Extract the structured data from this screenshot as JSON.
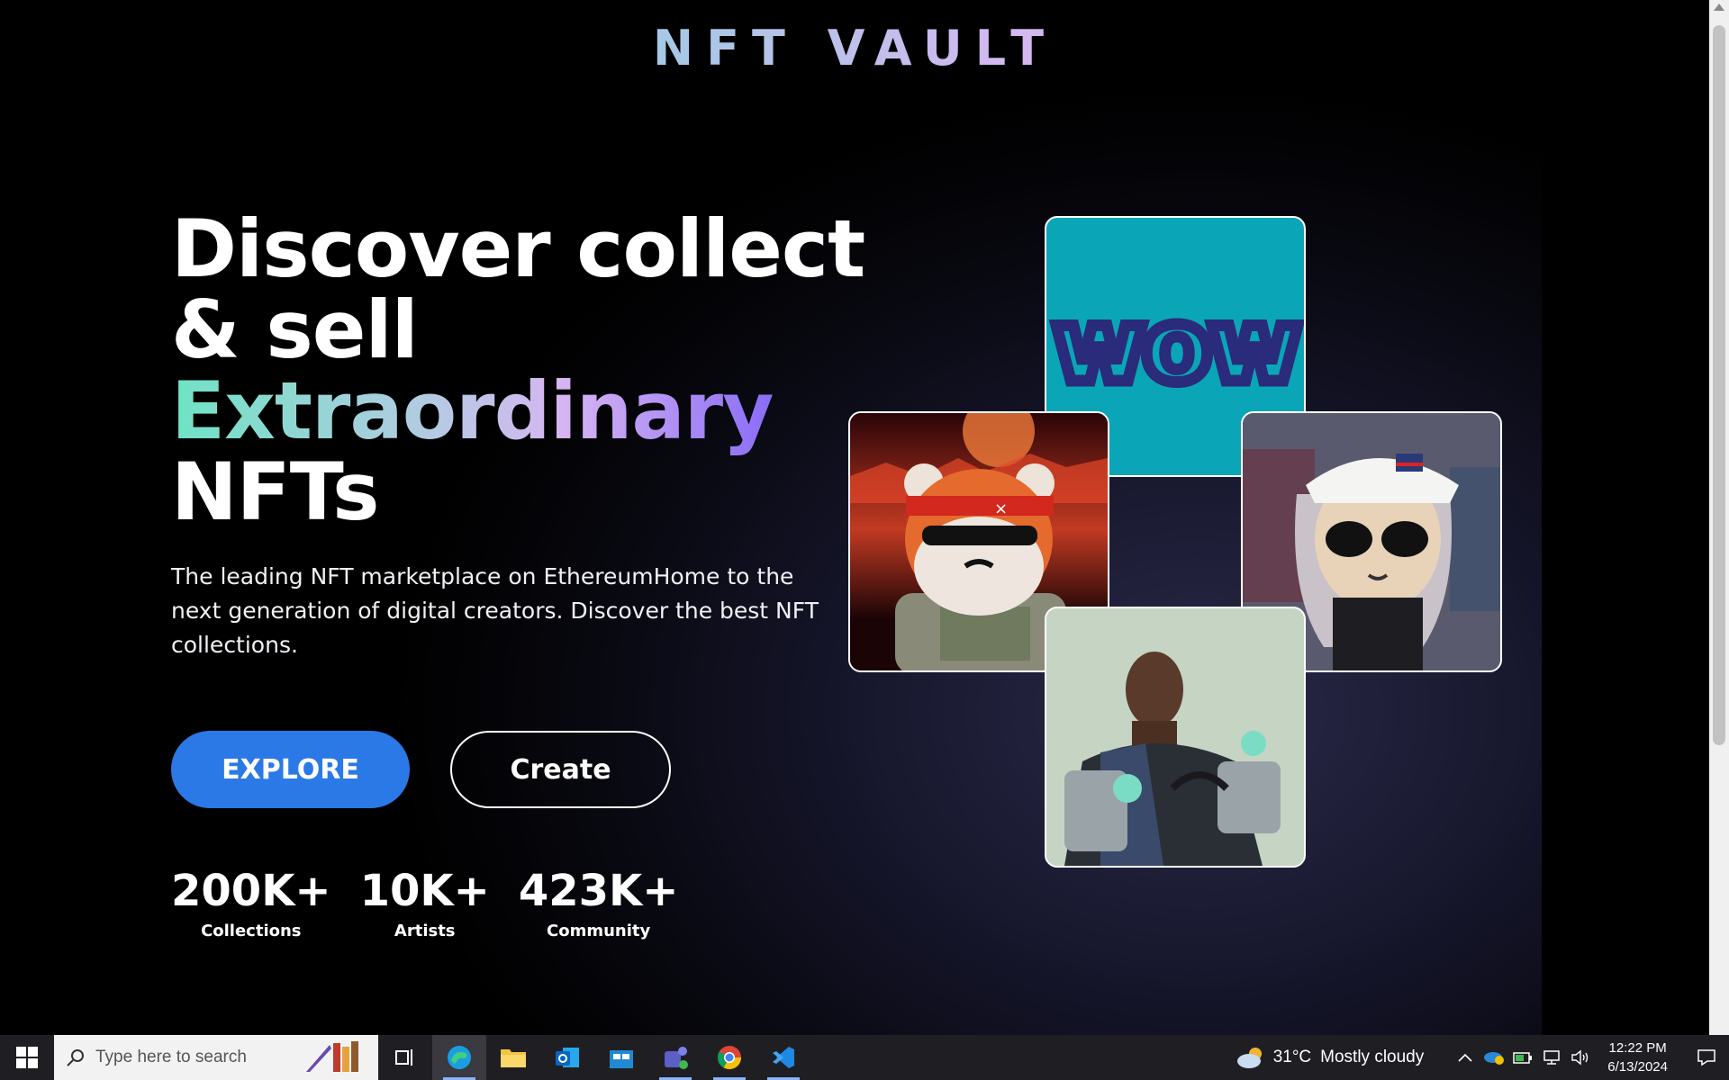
{
  "brand": "NFT VAULT",
  "hero": {
    "line1": "Discover collect",
    "line2": "& sell",
    "line3": "Extraordinary",
    "line4": "NFTs",
    "description": "The leading NFT marketplace on EthereumHome to the next generation of digital creators. Discover the best NFT collections.",
    "explore_label": "EXPLORE",
    "create_label": "Create"
  },
  "stats": [
    {
      "value": "200K+",
      "label": "Collections"
    },
    {
      "value": "10K+",
      "label": "Artists"
    },
    {
      "value": "423K+",
      "label": "Community"
    }
  ],
  "cards": {
    "wow_text": "wow"
  },
  "taskbar": {
    "search_placeholder": "Type here to search",
    "weather_temp": "31°C",
    "weather_desc": "Mostly cloudy",
    "time": "12:22 PM",
    "date": "6/13/2024"
  },
  "colors": {
    "accent_blue": "#2b79e6",
    "gradient_start": "#6fe3c4",
    "gradient_end": "#8a6cf6",
    "wow_bg": "#0aa6b8"
  }
}
